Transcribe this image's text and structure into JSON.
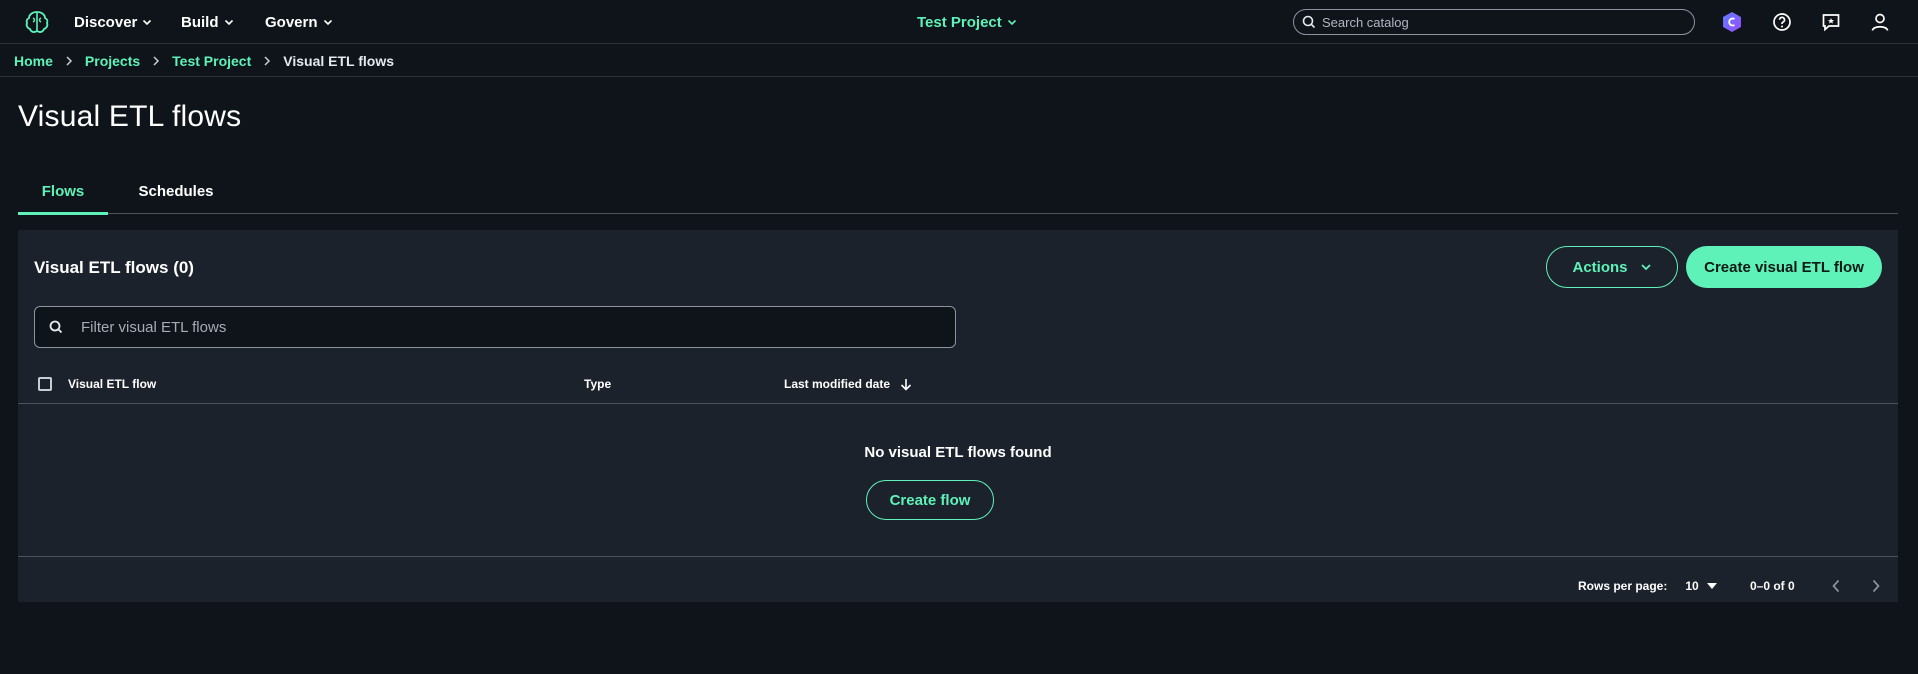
{
  "nav": {
    "menus": [
      "Discover",
      "Build",
      "Govern"
    ],
    "project": "Test Project",
    "search_placeholder": "Search catalog"
  },
  "breadcrumb": {
    "items": [
      "Home",
      "Projects",
      "Test Project"
    ],
    "current": "Visual ETL flows"
  },
  "page": {
    "title": "Visual ETL flows"
  },
  "tabs": [
    {
      "label": "Flows",
      "active": true
    },
    {
      "label": "Schedules",
      "active": false
    }
  ],
  "panel": {
    "title": "Visual ETL flows (0)",
    "actions_label": "Actions",
    "create_label": "Create visual ETL flow",
    "filter_placeholder": "Filter visual ETL flows",
    "columns": [
      "Visual ETL flow",
      "Type",
      "Last modified date"
    ],
    "empty_message": "No visual ETL flows found",
    "empty_action": "Create flow"
  },
  "pagination": {
    "rows_label": "Rows per page:",
    "rows_value": "10",
    "range": "0–0 of 0"
  },
  "colors": {
    "accent": "#5ff2b8",
    "background": "#0f141b",
    "panel": "#1b222c"
  }
}
